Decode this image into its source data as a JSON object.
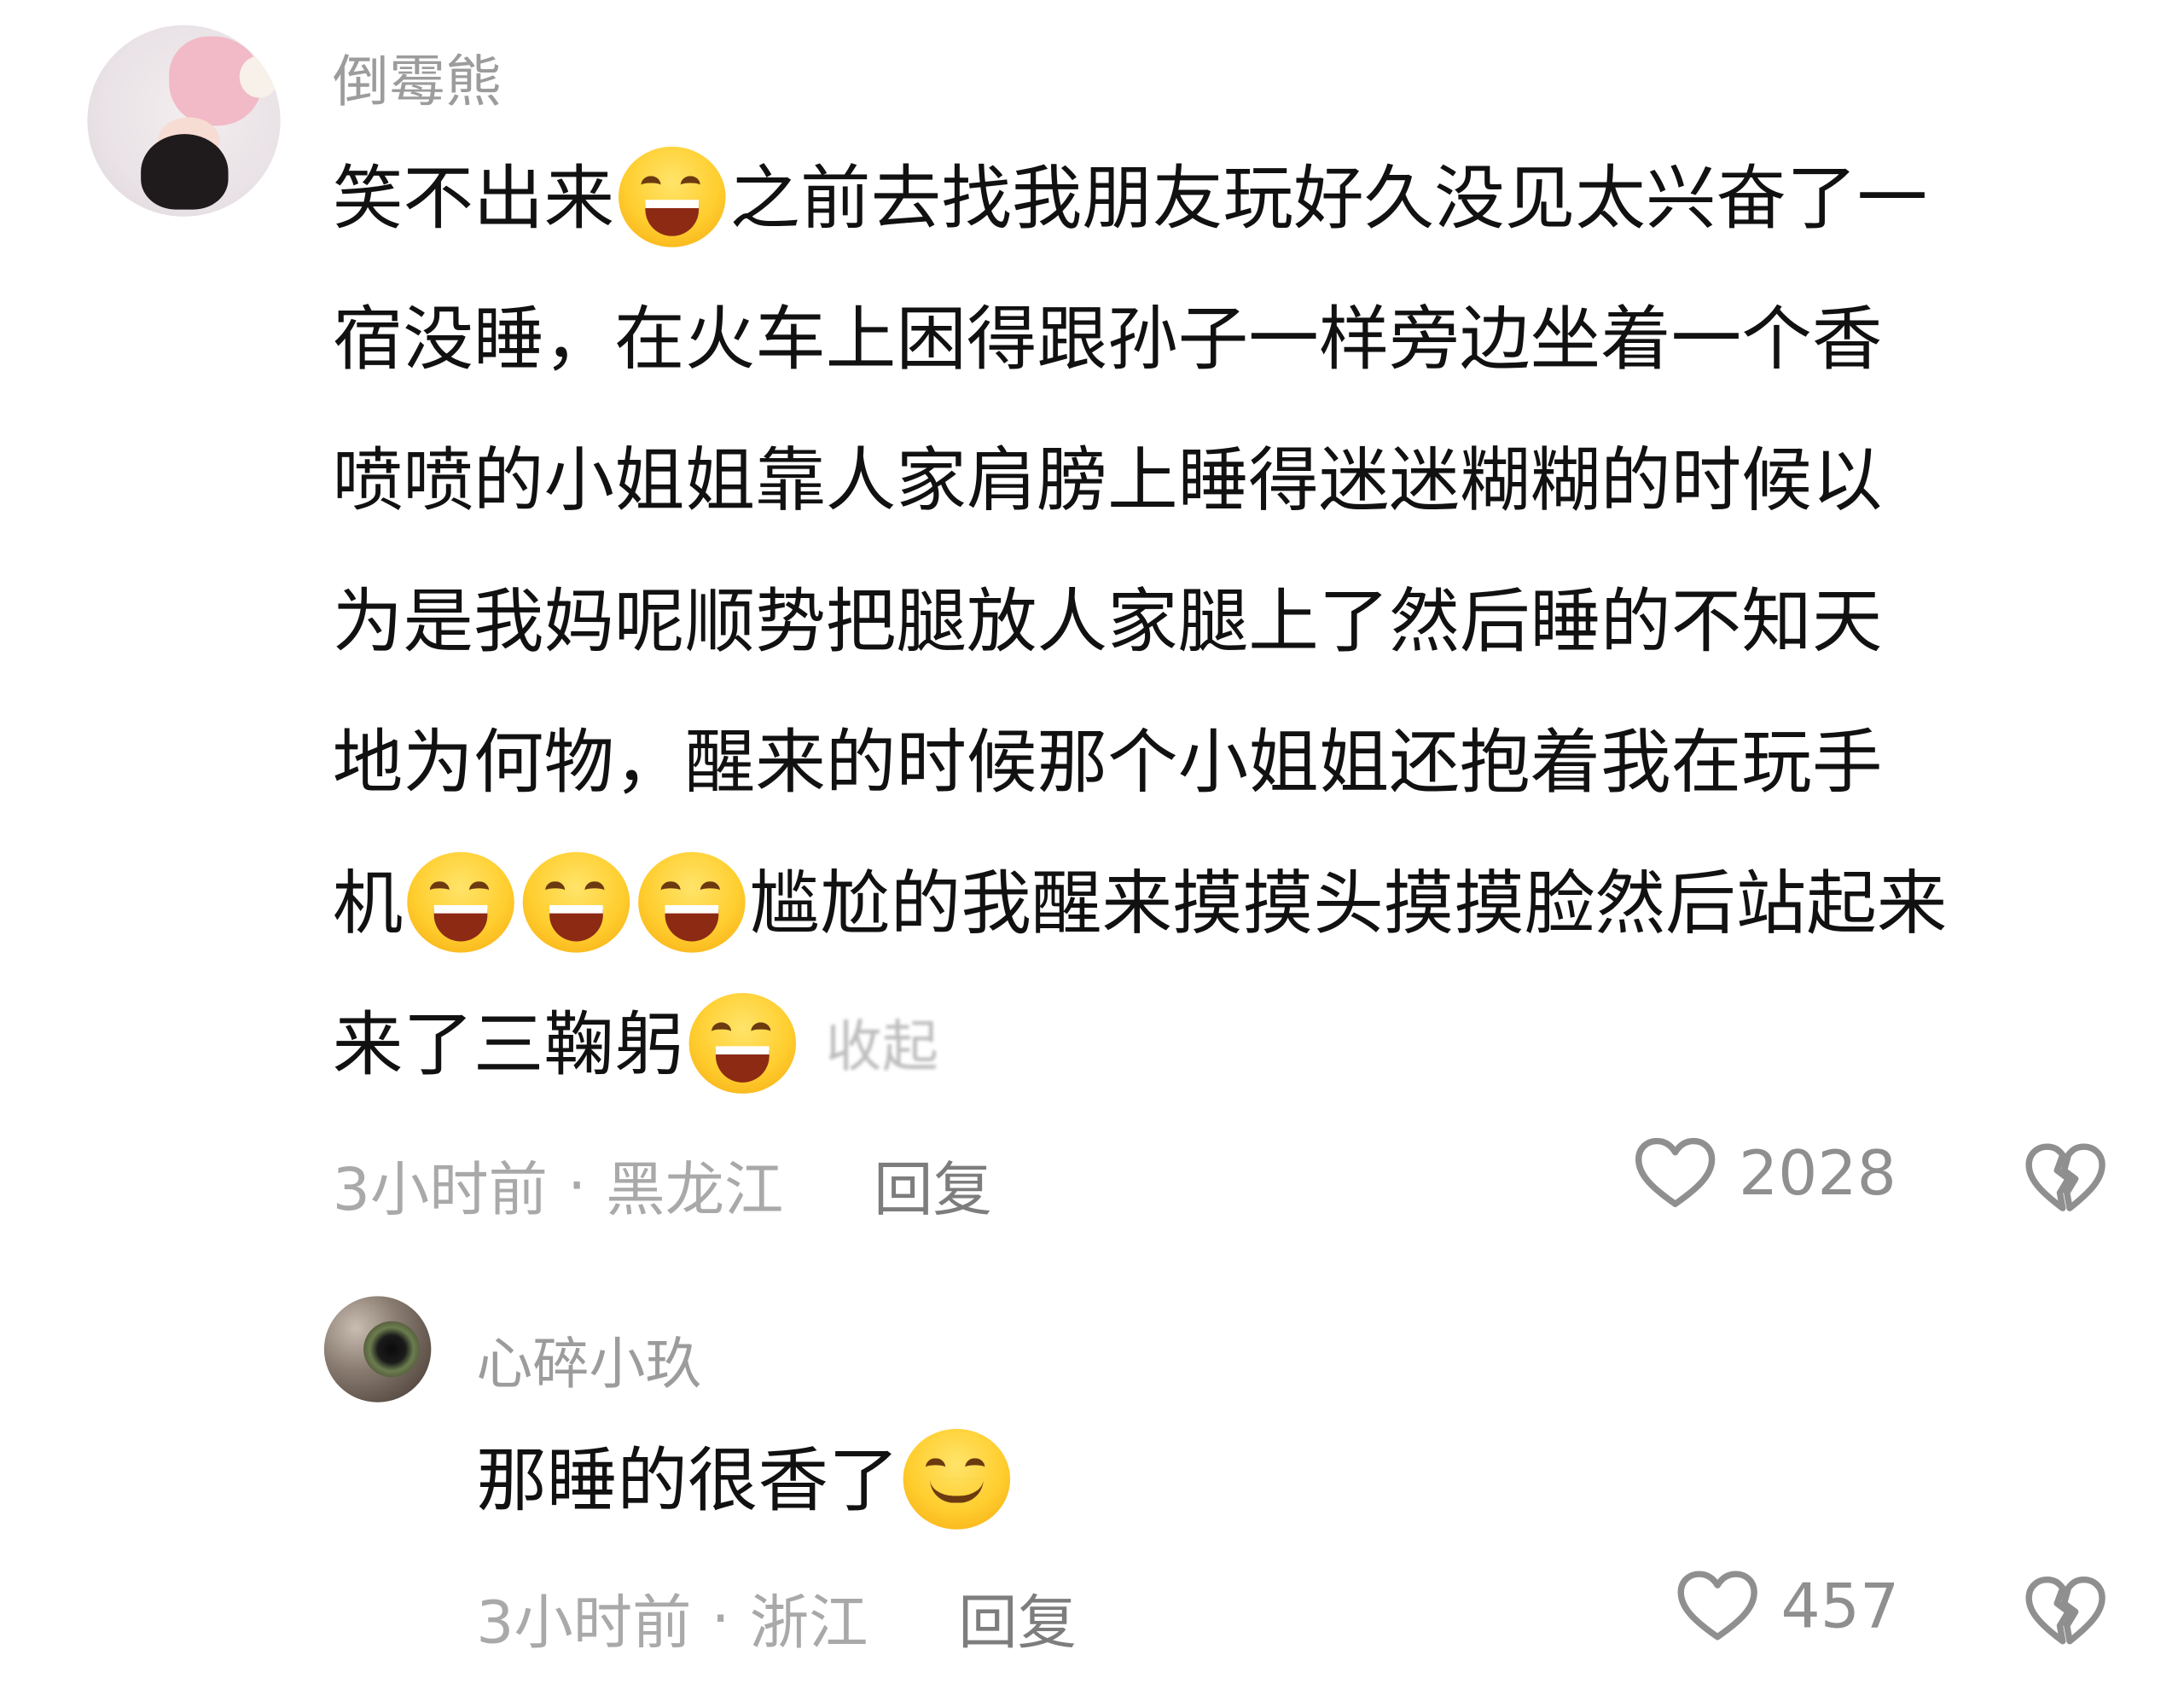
{
  "comment": {
    "username": "倒霉熊",
    "lines": [
      {
        "before": "笑不出来",
        "emojis": 1,
        "after": "之前去找我朋友玩好久没见太兴奋了一"
      },
      {
        "before": "宿没睡，在火车上困得跟孙子一样旁边坐着一个香",
        "emojis": 0,
        "after": ""
      },
      {
        "before": "喷喷的小姐姐靠人家肩膀上睡得迷迷糊糊的时候以",
        "emojis": 0,
        "after": ""
      },
      {
        "before": "为是我妈呢顺势把腿放人家腿上了然后睡的不知天",
        "emojis": 0,
        "after": ""
      },
      {
        "before": "地为何物，醒来的时候那个小姐姐还抱着我在玩手",
        "emojis": 0,
        "after": ""
      },
      {
        "before": "机",
        "emojis": 3,
        "after": "尴尬的我醒来摸摸头摸摸脸然后站起来"
      },
      {
        "before": "来了三鞠躬",
        "emojis": 1,
        "after": ""
      }
    ],
    "fold_label": "收起",
    "time": "3小时前",
    "separator": "·",
    "location": "黑龙江",
    "reply_label": "回复",
    "like_count": "2028"
  },
  "reply": {
    "username": "心碎小玖",
    "text": "那睡的很香了",
    "emoji": "smile",
    "time": "3小时前",
    "separator": "·",
    "location": "浙江",
    "reply_label": "回复",
    "like_count": "457"
  },
  "icons": {
    "like": "heart-outline-icon",
    "dislike": "broken-heart-outline-icon",
    "emoji_grin": "grinning-squinting-face-emoji",
    "emoji_smile": "smiling-face-emoji"
  },
  "colors": {
    "username": "#9c9c9c",
    "body": "#111111",
    "meta": "#a9a9a9",
    "icon": "#8f8f8f"
  }
}
